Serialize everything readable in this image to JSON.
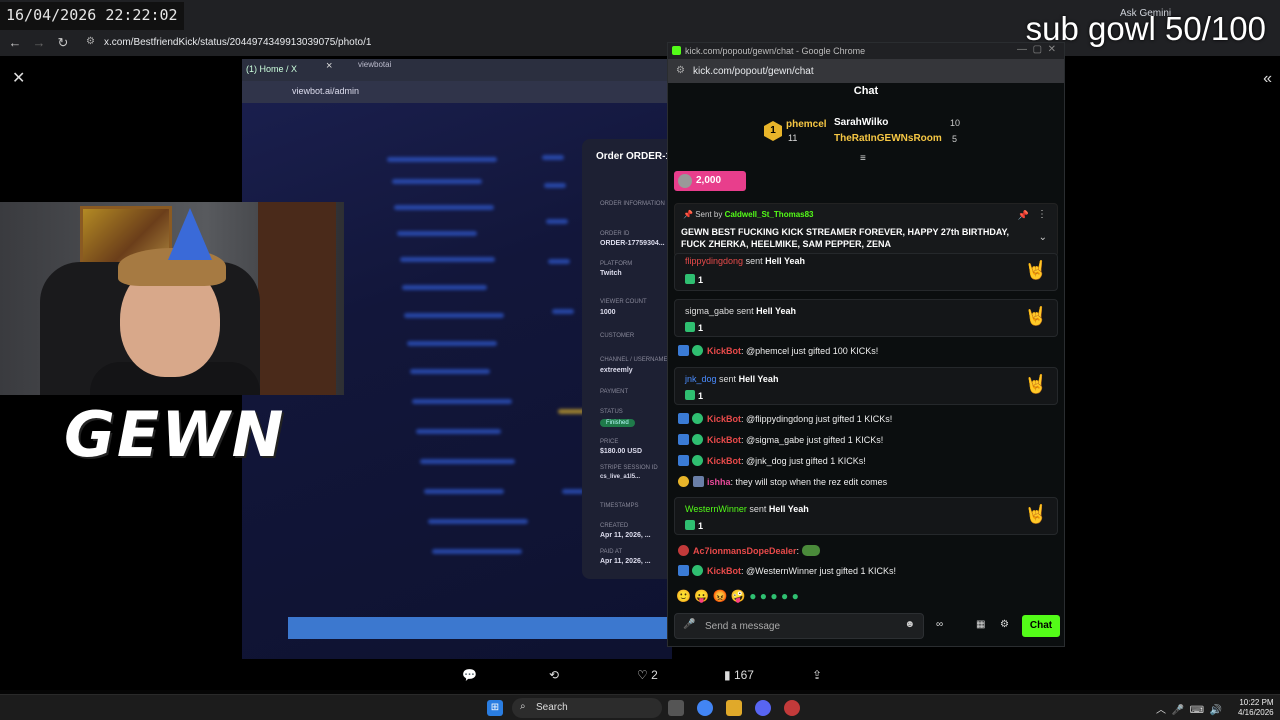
{
  "overlay": {
    "timestamp": "16/04/2026 22:22:02",
    "sub_goal": "sub gowl 50/100",
    "streamer_logo": "GEWN"
  },
  "browser": {
    "url": "x.com/BestfriendKick/status/2044974349913039075/photo/1",
    "ask_gemini": "Ask Gemini"
  },
  "photo_screen": {
    "tab_label": "(1) Home / X",
    "tab2_label": "viewbotai",
    "url": "viewbot.ai/admin",
    "order_title": "Order ORDER-17...",
    "fields": [
      {
        "label": "ORDER INFORMATION",
        "value": ""
      },
      {
        "label": "ORDER ID",
        "value": "ORDER-17759304..."
      },
      {
        "label": "PLATFORM",
        "value": "Twitch"
      },
      {
        "label": "VIEWER COUNT",
        "value": "1000"
      },
      {
        "label": "CUSTOMER",
        "value": ""
      },
      {
        "label": "CHANNEL / USERNAME",
        "value": "extreemly"
      },
      {
        "label": "PAYMENT",
        "value": ""
      },
      {
        "label": "STATUS",
        "value": ""
      },
      {
        "label": "PRICE",
        "value": "$180.00 USD"
      },
      {
        "label": "STRIPE SESSION ID",
        "value": "cs_live_a1I5..."
      },
      {
        "label": "TIMESTAMPS",
        "value": ""
      },
      {
        "label": "CREATED",
        "value": "Apr 11, 2026, ..."
      },
      {
        "label": "PAID AT",
        "value": "Apr 11, 2026, ..."
      }
    ],
    "status_pill": "Finished"
  },
  "chat": {
    "window_title": "kick.com/popout/gewn/chat - Google Chrome",
    "url": "kick.com/popout/gewn/chat",
    "header": "Chat",
    "leaderboard": {
      "first": {
        "rank": "1",
        "name": "phemcel",
        "count": "11"
      },
      "others": [
        {
          "name": "SarahWilko",
          "count": "10",
          "color": "#ffffff"
        },
        {
          "name": "TheRatInGEWNsRoom",
          "count": "5",
          "color": "#f6c744"
        }
      ]
    },
    "kicks_pill": "2,000",
    "pinned": {
      "prefix": "Sent by",
      "sender": "Caldwell_St_Thomas83",
      "message": "GEWN BEST FUCKING KICK STREAMER FOREVER, HAPPY 27th BIRTHDAY, FUCK ZHERKA, HEELMIKE, SAM PEPPER, ZENA"
    },
    "gift_cards": [
      {
        "user": "flippydingdong",
        "user_color": "#e84a4a",
        "action": "sent",
        "gift": "Hell Yeah",
        "count": "1"
      },
      {
        "user": "sigma_gabe",
        "user_color": "#dddddd",
        "action": "sent",
        "gift": "Hell Yeah",
        "count": "1"
      },
      {
        "user": "jnk_dog",
        "user_color": "#4a8cff",
        "action": "sent",
        "gift": "Hell Yeah",
        "count": "1"
      },
      {
        "user": "WesternWinner",
        "user_color": "#53fc18",
        "action": "sent",
        "gift": "Hell Yeah",
        "count": "1"
      }
    ],
    "messages": [
      {
        "user": "KickBot",
        "text": ": @phemcel just gifted 100 KICKs!"
      },
      {
        "user": "KickBot",
        "text": ": @flippydingdong just gifted 1 KICKs!"
      },
      {
        "user": "KickBot",
        "text": ": @sigma_gabe just gifted 1 KICKs!"
      },
      {
        "user": "KickBot",
        "text": ": @jnk_dog just gifted 1 KICKs!"
      },
      {
        "user": "ishha",
        "text": ": they will stop when the rez edit comes"
      },
      {
        "user": "Ac7ionmansDopeDealer",
        "text": ":"
      },
      {
        "user": "KickBot",
        "text": ": @WesternWinner just gifted 1 KICKs!"
      }
    ],
    "input_placeholder": "Send a message",
    "send_label": "Chat"
  },
  "tweet": {
    "retweets": "",
    "likes": "2",
    "views": "167"
  },
  "taskbar": {
    "search": "Search",
    "time": "10:22 PM",
    "date": "4/16/2026"
  }
}
